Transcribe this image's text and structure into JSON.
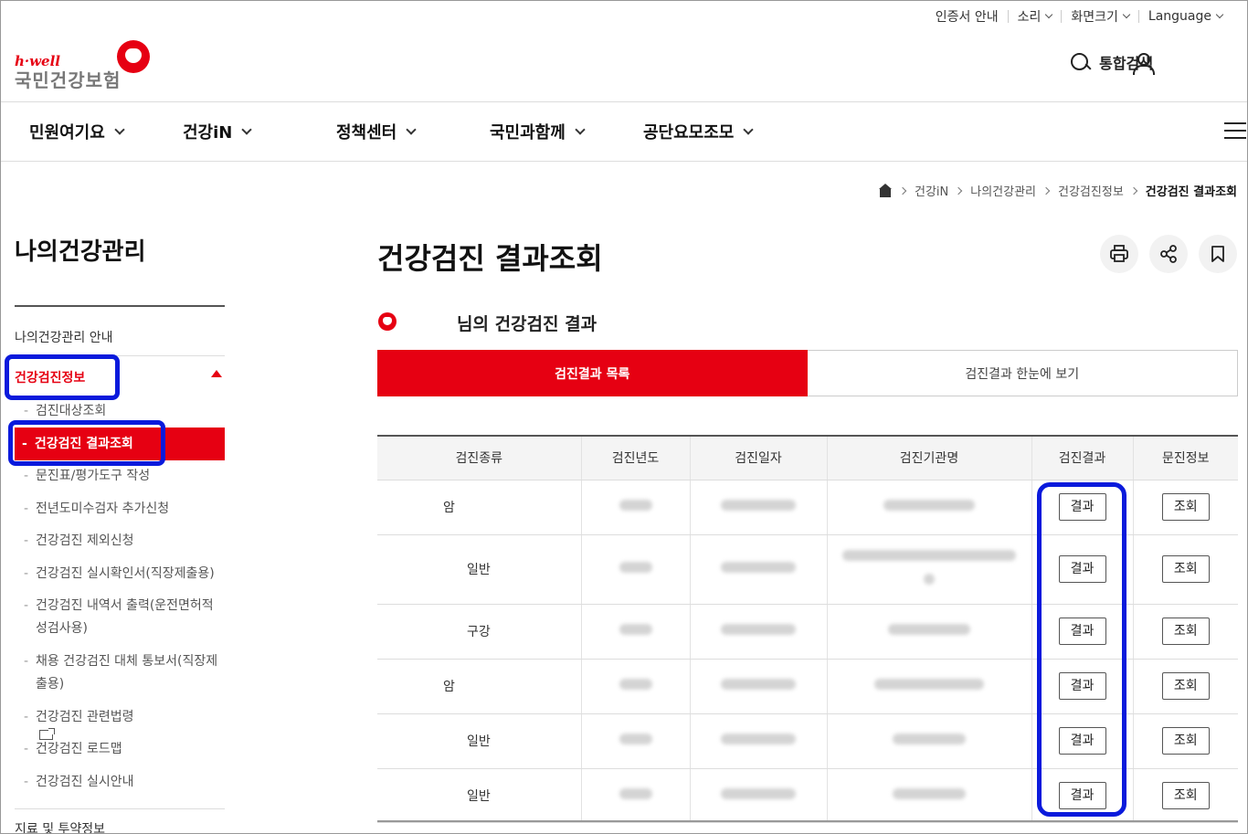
{
  "util": {
    "cert": "인증서 안내",
    "sound": "소리",
    "screen": "화면크기",
    "language": "Language"
  },
  "logo": {
    "en": "h·well",
    "ko": "국민건강보험"
  },
  "header": {
    "search": "통합검색"
  },
  "gnb": [
    "민원여기요",
    "건강iN",
    "정책센터",
    "국민과함께",
    "공단요모조모"
  ],
  "breadcrumb": [
    "건강iN",
    "나의건강관리",
    "건강검진정보",
    "건강검진 결과조회"
  ],
  "sidebar": {
    "title": "나의건강관리",
    "item_guide": "나의건강관리 안내",
    "item_info": "건강검진정보",
    "subs": [
      "검진대상조회",
      "건강검진 결과조회",
      "문진표/평가도구 작성",
      "전년도미수검자 추가신청",
      "건강검진 제외신청",
      "건강검진 실시확인서(직장제출용)",
      "건강검진 내역서 출력(운전면허적성검사용)",
      "채용 건강검진 대체 통보서(직장제출용)",
      "건강검진 관련법령",
      "건강검진 로드맵",
      "건강검진 실시안내"
    ],
    "next_item": "지료 및 투약정보"
  },
  "main": {
    "title": "건강검진 결과조회",
    "subtitle": "님의 건강검진 결과",
    "tabs": [
      "검진결과 목록",
      "검진결과 한눈에 보기"
    ],
    "table": {
      "headers": [
        "검진종류",
        "검진년도",
        "검진일자",
        "검진기관명",
        "검진결과",
        "문진정보"
      ],
      "rows": [
        {
          "kind": "암",
          "indent": 0
        },
        {
          "kind": "일반",
          "indent": 1
        },
        {
          "kind": "구강",
          "indent": 1
        },
        {
          "kind": "암",
          "indent": 0
        },
        {
          "kind": "일반",
          "indent": 1
        },
        {
          "kind": "일반",
          "indent": 1
        }
      ],
      "result_btn": "결과",
      "inquiry_btn": "조회"
    }
  },
  "colors": {
    "brand_red": "#e60012",
    "highlight_blue": "#0a1adc"
  }
}
